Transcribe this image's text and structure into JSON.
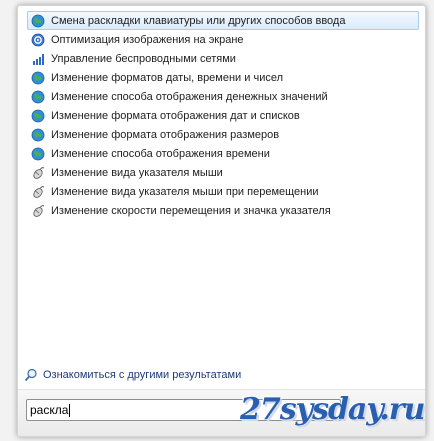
{
  "results": [
    {
      "label": "Смена раскладки клавиатуры или других способов ввода",
      "icon": "region-globe-icon",
      "selected": true
    },
    {
      "label": "Оптимизация изображения на экране",
      "icon": "ease-of-access-icon"
    },
    {
      "label": "Управление беспроводными сетями",
      "icon": "network-icon"
    },
    {
      "label": "Изменение форматов даты, времени и чисел",
      "icon": "region-globe-icon"
    },
    {
      "label": "Изменение способа отображения денежных значений",
      "icon": "region-globe-icon"
    },
    {
      "label": "Изменение формата отображения дат и списков",
      "icon": "region-globe-icon"
    },
    {
      "label": "Изменение формата отображения размеров",
      "icon": "region-globe-icon"
    },
    {
      "label": "Изменение способа отображения времени",
      "icon": "region-globe-icon"
    },
    {
      "label": "Изменение вида указателя мыши",
      "icon": "mouse-icon"
    },
    {
      "label": "Изменение вида указателя мыши при перемещении",
      "icon": "mouse-icon"
    },
    {
      "label": "Изменение скорости перемещения и значка указателя",
      "icon": "mouse-icon"
    }
  ],
  "more_results_label": "Ознакомиться с другими результатами",
  "search": {
    "value": "раскла"
  },
  "watermark": "27sysday.ru",
  "colors": {
    "selection": "#dcecfc",
    "link": "#1f3b7a",
    "watermark": "#2a5fb0"
  }
}
